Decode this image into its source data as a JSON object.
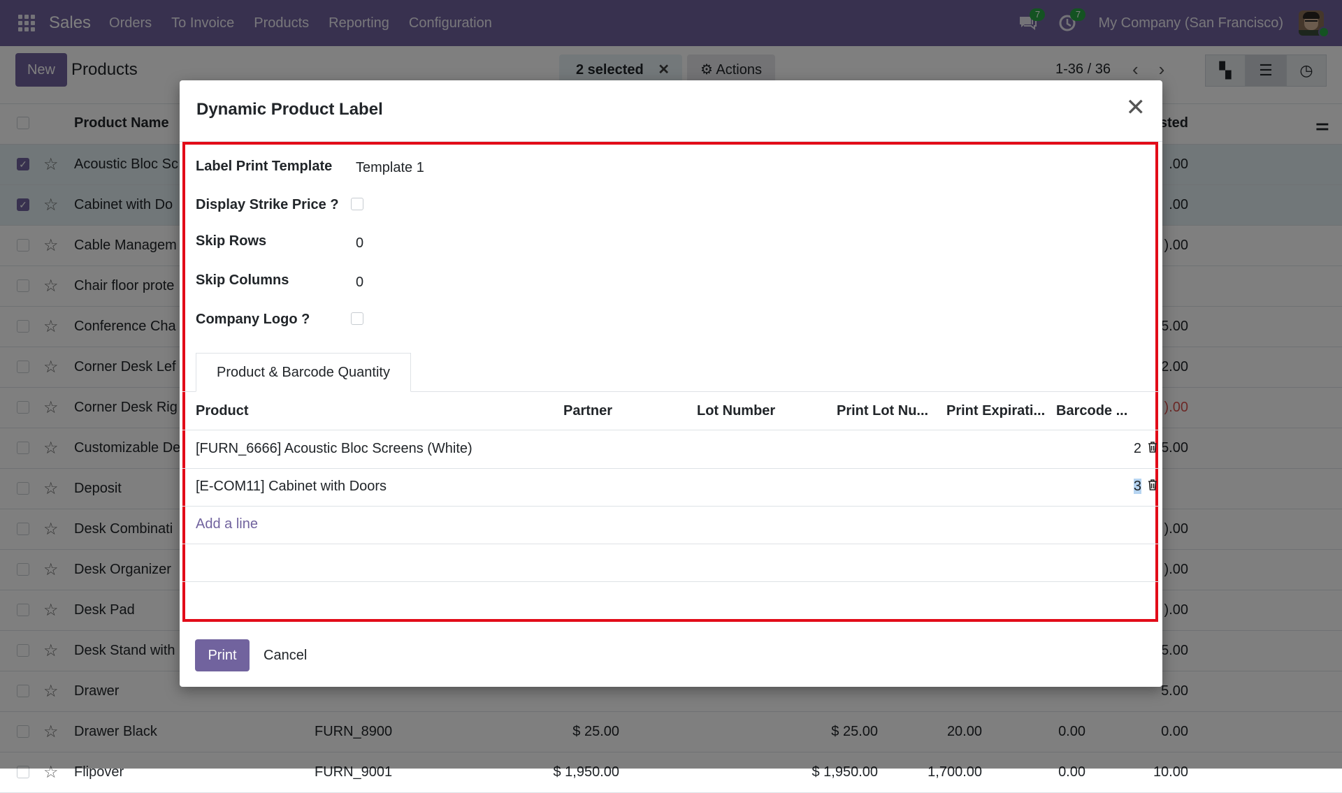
{
  "navbar": {
    "brand": "Sales",
    "menu": [
      "Orders",
      "To Invoice",
      "Products",
      "Reporting",
      "Configuration"
    ],
    "messages_badge": "7",
    "activities_badge": "7",
    "company": "My Company (San Francisco)"
  },
  "control_panel": {
    "new_label": "New",
    "title": "Products",
    "selected_label": "2 selected",
    "actions_label": "Actions",
    "pager": "1-36 / 36"
  },
  "list": {
    "header": {
      "name": "Product Name",
      "partial": "sted"
    },
    "rows": [
      {
        "name": "Acoustic Bloc Sc",
        "tail": ".00",
        "selected": true
      },
      {
        "name": "Cabinet with Do",
        "tail": ".00",
        "selected": true
      },
      {
        "name": "Cable Managem",
        "tail": ").00"
      },
      {
        "name": "Chair floor prote",
        "tail": ""
      },
      {
        "name": "Conference Cha",
        "tail": "5.00"
      },
      {
        "name": "Corner Desk Lef",
        "tail": "2.00"
      },
      {
        "name": "Corner Desk Rig",
        "tail": ").00",
        "red": true
      },
      {
        "name": "Customizable De",
        "tail": "5.00"
      },
      {
        "name": "Deposit",
        "tail": ""
      },
      {
        "name": "Desk Combinati",
        "tail": ").00"
      },
      {
        "name": "Desk Organizer",
        "tail": ").00"
      },
      {
        "name": "Desk Pad",
        "tail": ").00"
      },
      {
        "name": "Desk Stand with",
        "tail": "5.00"
      },
      {
        "name": "Drawer",
        "tail": "5.00"
      },
      {
        "name": "Drawer Black",
        "ref": "FURN_8900",
        "c1": "$ 25.00",
        "c2": "$ 25.00",
        "c3": "20.00",
        "c4": "0.00",
        "tail": "0.00"
      },
      {
        "name": "Flipover",
        "ref": "FURN_9001",
        "c1": "$ 1,950.00",
        "c2": "$ 1,950.00",
        "c3": "1,700.00",
        "c4": "0.00",
        "tail": "10.00"
      }
    ]
  },
  "modal": {
    "title": "Dynamic Product Label",
    "fields": {
      "template_label": "Label Print Template",
      "template_value": "Template 1",
      "strike_label": "Display Strike Price ?",
      "skip_rows_label": "Skip Rows",
      "skip_rows_value": "0",
      "skip_cols_label": "Skip Columns",
      "skip_cols_value": "0",
      "logo_label": "Company Logo ?"
    },
    "tab_label": "Product & Barcode Quantity",
    "columns": [
      "Product",
      "Partner",
      "Lot Number",
      "Print Lot Nu...",
      "Print Expirati...",
      "Barcode ..."
    ],
    "lines": [
      {
        "product": "[FURN_6666] Acoustic Bloc Screens (White)",
        "qty": "2"
      },
      {
        "product": "[E-COM11] Cabinet with Doors",
        "qty": "3"
      }
    ],
    "add_line": "Add a line",
    "print_label": "Print",
    "cancel_label": "Cancel"
  }
}
